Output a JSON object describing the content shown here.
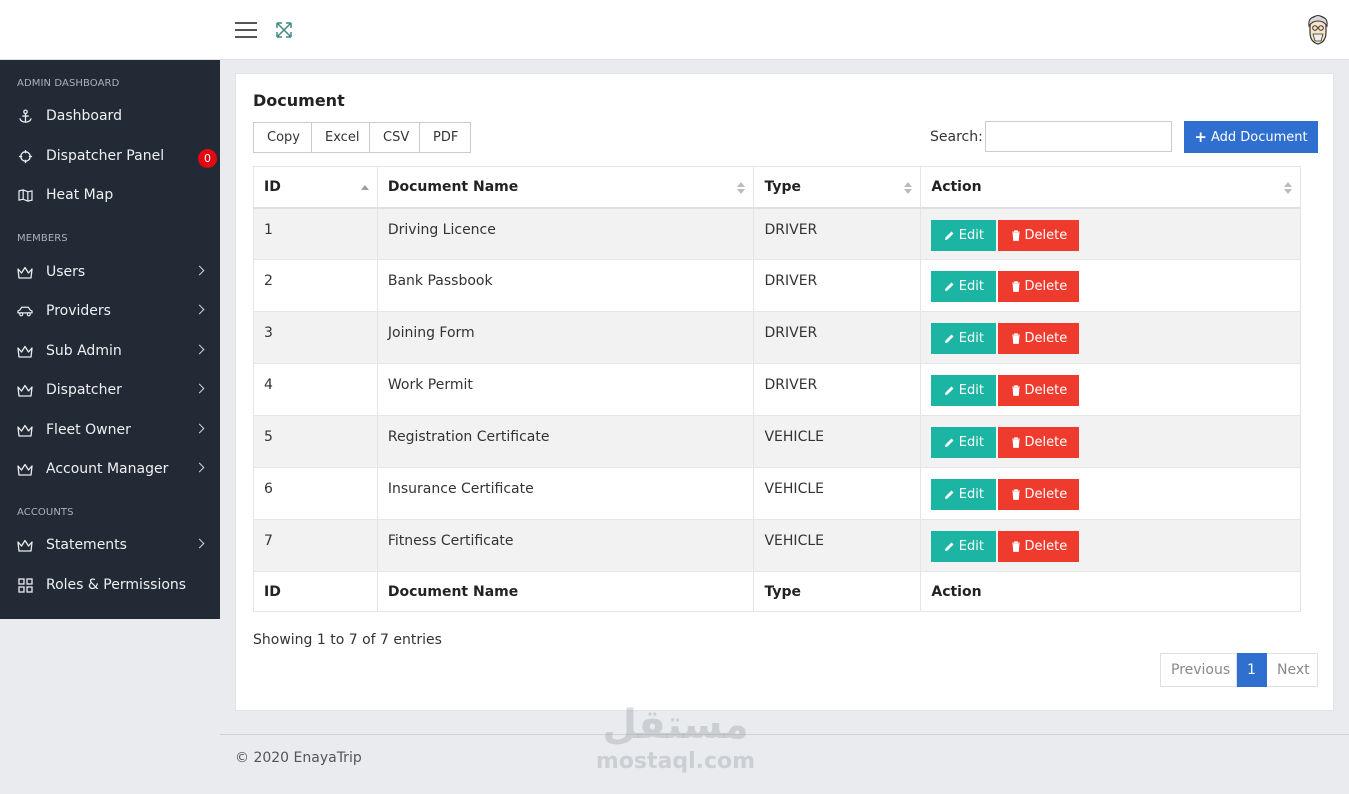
{
  "topbar": {
    "menu_icon": "hamburger-icon",
    "expand_icon": "expand-icon",
    "avatar_icon": "user-avatar-icon"
  },
  "sidebar": {
    "sections": [
      {
        "title": "ADMIN DASHBOARD",
        "items": [
          {
            "label": "Dashboard",
            "icon": "anchor-icon",
            "has_children": false
          },
          {
            "label": "Dispatcher Panel",
            "icon": "crosshair-icon",
            "has_children": false,
            "badge": "0"
          },
          {
            "label": "Heat Map",
            "icon": "map-icon",
            "has_children": false
          }
        ]
      },
      {
        "title": "MEMBERS",
        "items": [
          {
            "label": "Users",
            "icon": "crown-icon",
            "has_children": true
          },
          {
            "label": "Providers",
            "icon": "car-icon",
            "has_children": true
          },
          {
            "label": "Sub Admin",
            "icon": "crown-icon",
            "has_children": true
          },
          {
            "label": "Dispatcher",
            "icon": "crown-icon",
            "has_children": true
          },
          {
            "label": "Fleet Owner",
            "icon": "crown-icon",
            "has_children": true
          },
          {
            "label": "Account Manager",
            "icon": "crown-icon",
            "has_children": true
          }
        ]
      },
      {
        "title": "ACCOUNTS",
        "items": [
          {
            "label": "Statements",
            "icon": "crown-icon",
            "has_children": true
          },
          {
            "label": "Roles & Permissions",
            "icon": "grid-icon",
            "has_children": false
          }
        ]
      }
    ]
  },
  "main": {
    "title": "Document",
    "export_buttons": [
      "Copy",
      "Excel",
      "CSV",
      "PDF"
    ],
    "search_label": "Search:",
    "search_value": "",
    "add_button": "Add Document",
    "table": {
      "columns": [
        "ID",
        "Document Name",
        "Type",
        "Action"
      ],
      "rows": [
        {
          "id": "1",
          "name": "Driving Licence",
          "type": "DRIVER"
        },
        {
          "id": "2",
          "name": "Bank Passbook",
          "type": "DRIVER"
        },
        {
          "id": "3",
          "name": "Joining Form",
          "type": "DRIVER"
        },
        {
          "id": "4",
          "name": "Work Permit",
          "type": "DRIVER"
        },
        {
          "id": "5",
          "name": "Registration Certificate",
          "type": "VEHICLE"
        },
        {
          "id": "6",
          "name": "Insurance Certificate",
          "type": "VEHICLE"
        },
        {
          "id": "7",
          "name": "Fitness Certificate",
          "type": "VEHICLE"
        }
      ],
      "edit_label": "Edit",
      "delete_label": "Delete"
    },
    "info": "Showing 1 to 7 of 7 entries",
    "pagination": {
      "previous": "Previous",
      "current": "1",
      "next": "Next"
    }
  },
  "footer": {
    "copyright": "© 2020 EnayaTrip"
  },
  "watermark": {
    "arabic": "مستقل",
    "latin": "mostaql.com"
  }
}
